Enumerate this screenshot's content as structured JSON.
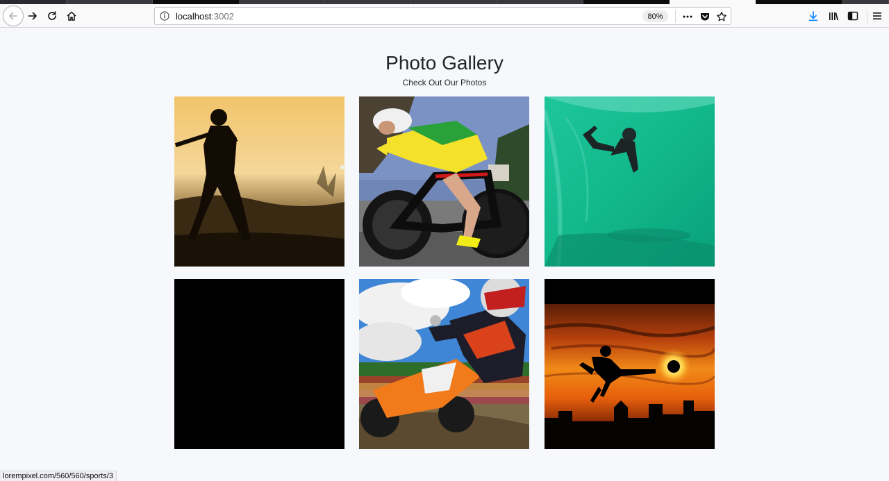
{
  "browser": {
    "url_host": "localhost",
    "url_port": ":3002",
    "zoom": "80%",
    "status_link": "lorempixel.com/560/560/sports/3"
  },
  "page": {
    "title": "Photo Gallery",
    "subtitle": "Check Out Our Photos"
  },
  "photos": [
    {
      "subject": "cricket-silhouette"
    },
    {
      "subject": "cyclist"
    },
    {
      "subject": "surfer"
    },
    {
      "subject": "blank"
    },
    {
      "subject": "motocross"
    },
    {
      "subject": "football-sunset"
    }
  ],
  "icons": {
    "back": "back-arrow-icon",
    "forward": "forward-arrow-icon",
    "reload": "reload-icon",
    "home": "home-icon",
    "info": "info-icon",
    "more": "more-icon",
    "pocket": "pocket-icon",
    "bookmark": "star-icon",
    "downloads": "download-icon",
    "library": "library-icon",
    "sidebar": "sidebar-icon",
    "menu": "hamburger-menu-icon"
  }
}
